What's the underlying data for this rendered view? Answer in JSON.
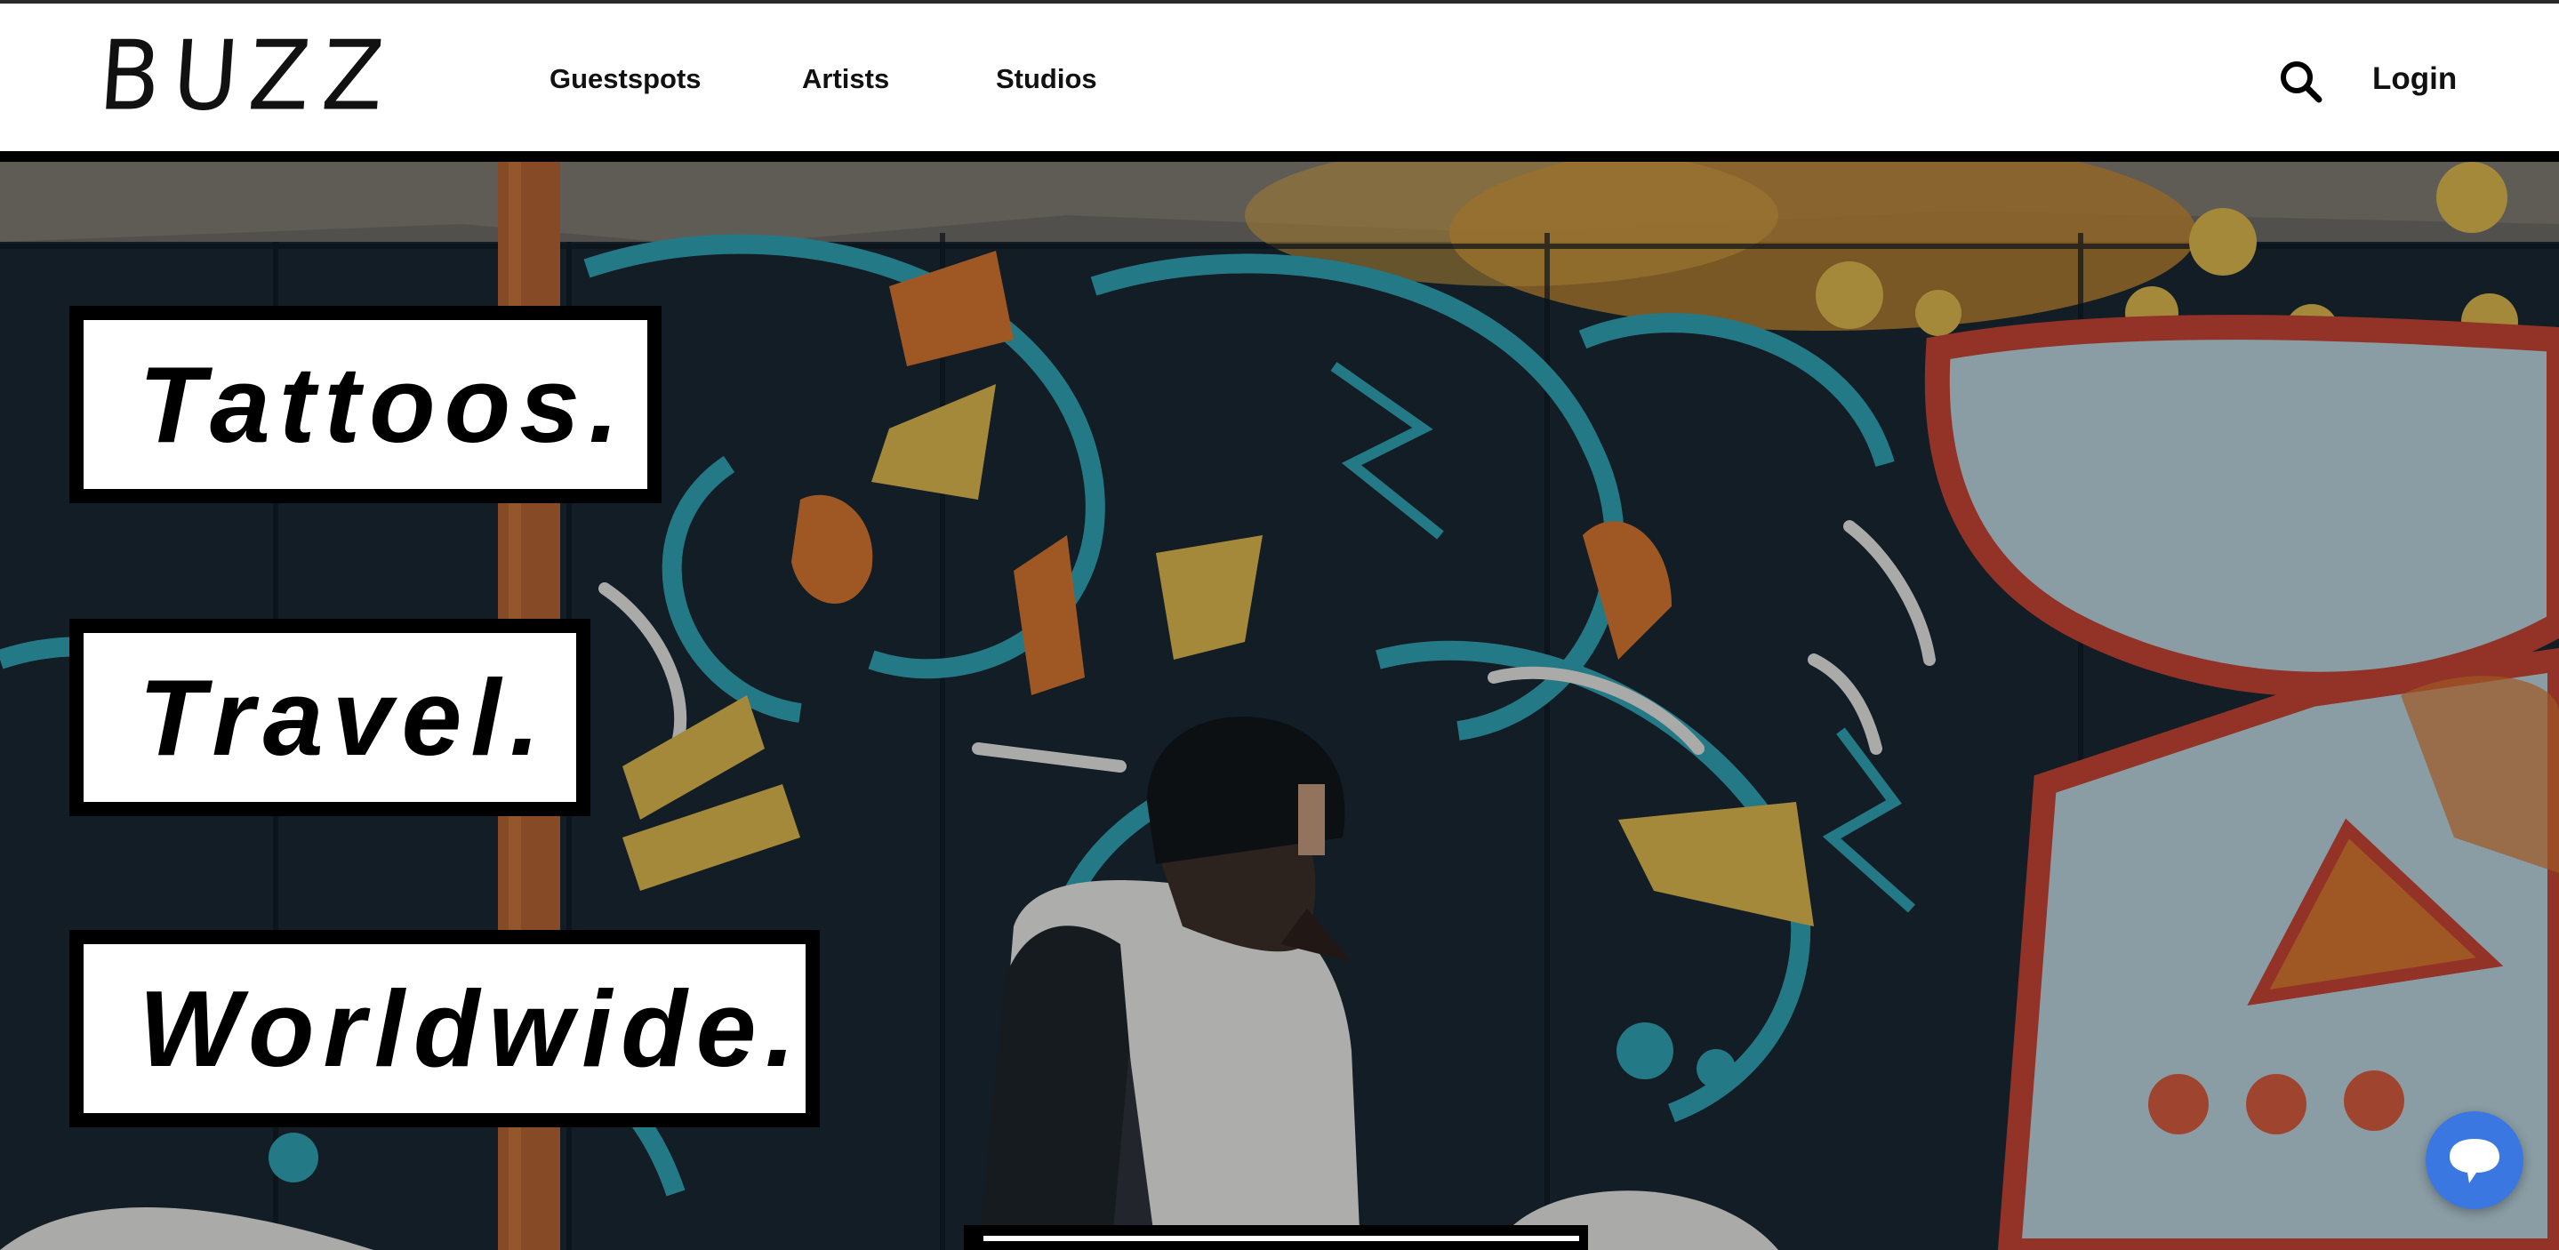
{
  "brand": {
    "logo_text": "BUZZ"
  },
  "nav": {
    "items": [
      {
        "label": "Guestspots"
      },
      {
        "label": "Artists"
      },
      {
        "label": "Studios"
      }
    ],
    "login_label": "Login",
    "search_icon": "search-icon"
  },
  "hero": {
    "taglines": [
      "Tattoos.",
      "Travel.",
      "Worldwide."
    ],
    "background": "graffiti wall photo",
    "colors": {
      "teal": "#2fa3b3",
      "orange": "#d8752a",
      "yellow": "#e0b94a",
      "navy": "#142029",
      "red": "#c8412e",
      "lightblue": "#bcd4dc"
    }
  },
  "chat": {
    "icon": "chat-bubble-icon",
    "color": "#3a77e0"
  }
}
